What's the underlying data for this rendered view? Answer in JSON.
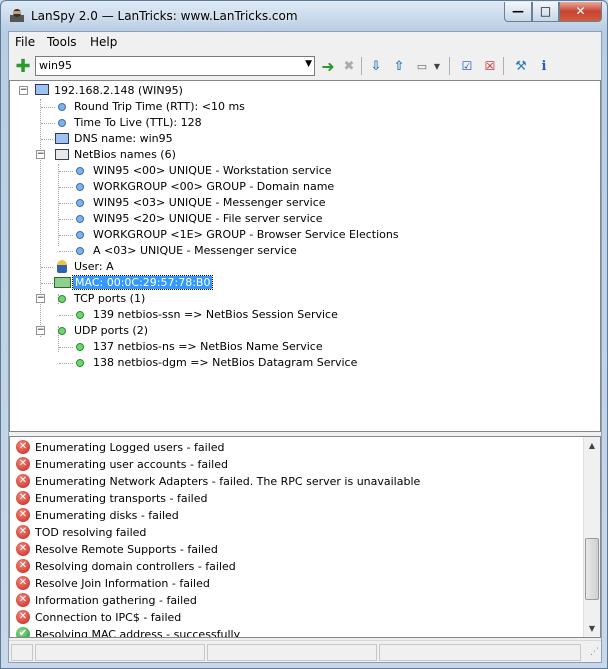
{
  "window": {
    "title": "LanSpy 2.0 — LanTricks: www.LanTricks.com"
  },
  "titlebar_buttons": {
    "minimize": "—",
    "maximize": "□",
    "close": "✕"
  },
  "menu": [
    "File",
    "Tools",
    "Help"
  ],
  "toolbar": {
    "address": "win95"
  },
  "tree": {
    "root": "192.168.2.148 (WIN95)",
    "items": [
      "Round Trip Time (RTT): <10 ms",
      "Time To Live (TTL): 128",
      "DNS name: win95",
      "NetBios names (6)",
      "WIN95 <00> UNIQUE - Workstation service",
      "WORKGROUP <00> GROUP - Domain name",
      "WIN95 <03> UNIQUE - Messenger service",
      "WIN95 <20> UNIQUE - File server service",
      "WORKGROUP <1E> GROUP - Browser Service Elections",
      "A <03> UNIQUE - Messenger service",
      "User: A",
      "MAC: 00:0C:29:57:78:B0",
      "TCP ports (1)",
      "139 netbios-ssn => NetBios Session Service",
      "UDP ports (2)",
      "137 netbios-ns => NetBios Name Service",
      "138 netbios-dgm => NetBios Datagram Service"
    ]
  },
  "log": [
    {
      "text": "Enumerating Logged users - failed",
      "status": "error"
    },
    {
      "text": "Enumerating user accounts - failed",
      "status": "error"
    },
    {
      "text": "Enumerating Network Adapters - failed. The RPC server is unavailable",
      "status": "error"
    },
    {
      "text": "Enumerating transports - failed",
      "status": "error"
    },
    {
      "text": "Enumerating disks -  failed",
      "status": "error"
    },
    {
      "text": "TOD resolving failed",
      "status": "error"
    },
    {
      "text": "Resolve Remote Supports - failed",
      "status": "error"
    },
    {
      "text": "Resolving domain controllers - failed",
      "status": "error"
    },
    {
      "text": "Resolve Join Information - failed",
      "status": "error"
    },
    {
      "text": "Information gathering - failed",
      "status": "error"
    },
    {
      "text": "Connection to IPC$ - failed",
      "status": "error"
    },
    {
      "text": "Resolving MAC address - successfully",
      "status": "ok"
    }
  ],
  "colors": {
    "selection": "#3399ff",
    "error": "#c8201a",
    "ok": "#1f8f2a"
  }
}
